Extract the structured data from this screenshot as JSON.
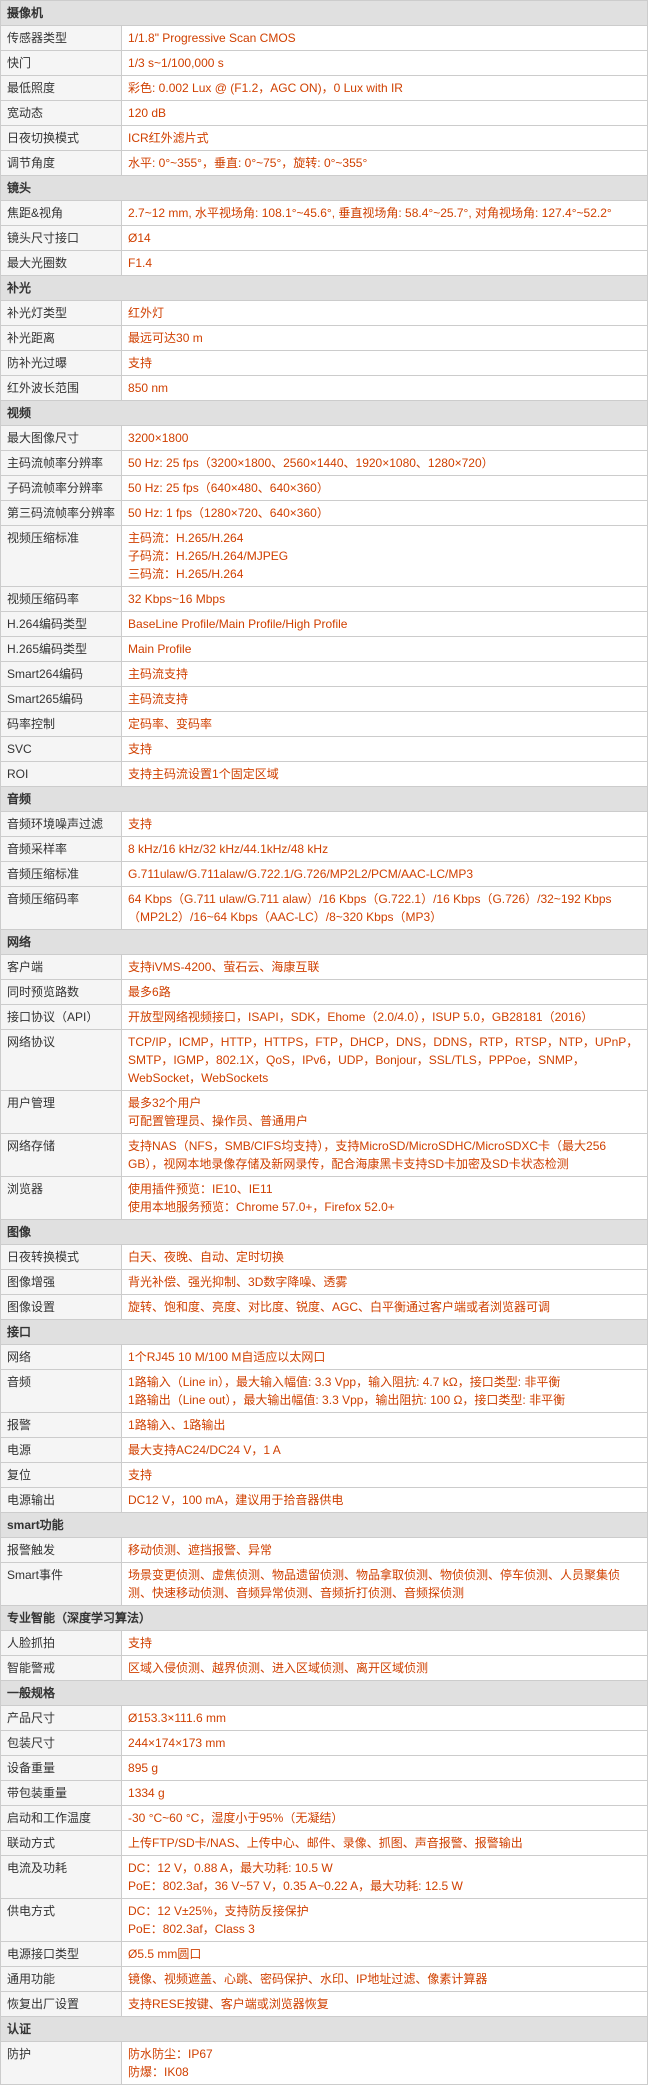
{
  "sections": [
    {
      "header": "摄像机",
      "rows": [
        {
          "label": "传感器类型",
          "value": "1/1.8\" Progressive Scan CMOS"
        },
        {
          "label": "快门",
          "value": "1/3 s~1/100,000 s"
        },
        {
          "label": "最低照度",
          "value": "彩色: 0.002 Lux @ (F1.2，AGC ON)，0 Lux with IR"
        },
        {
          "label": "宽动态",
          "value": "120 dB"
        },
        {
          "label": "日夜切换模式",
          "value": "ICR红外滤片式"
        },
        {
          "label": "调节角度",
          "value": "水平: 0°~355°，垂直: 0°~75°，旋转: 0°~355°"
        }
      ]
    },
    {
      "header": "镜头",
      "rows": [
        {
          "label": "焦距&视角",
          "value": "2.7~12 mm, 水平视场角: 108.1°~45.6°, 垂直视场角: 58.4°~25.7°, 对角视场角: 127.4°~52.2°"
        },
        {
          "label": "镜头尺寸接口",
          "value": "Ø14"
        },
        {
          "label": "最大光圈数",
          "value": "F1.4"
        }
      ]
    },
    {
      "header": "补光",
      "rows": [
        {
          "label": "补光灯类型",
          "value": "红外灯"
        },
        {
          "label": "补光距离",
          "value": "最远可达30 m"
        },
        {
          "label": "防补光过曝",
          "value": "支持"
        },
        {
          "label": "红外波长范围",
          "value": "850 nm"
        }
      ]
    },
    {
      "header": "视频",
      "rows": [
        {
          "label": "最大图像尺寸",
          "value": "3200×1800"
        },
        {
          "label": "主码流帧率分辨率",
          "value": "50 Hz: 25 fps（3200×1800、2560×1440、1920×1080、1280×720）"
        },
        {
          "label": "子码流帧率分辨率",
          "value": "50 Hz: 25 fps（640×480、640×360）"
        },
        {
          "label": "第三码流帧率分辨率",
          "value": "50 Hz: 1 fps（1280×720、640×360）"
        },
        {
          "label": "视频压缩标准",
          "value_multi": [
            "主码流：H.265/H.264",
            "子码流：H.265/H.264/MJPEG",
            "三码流：H.265/H.264"
          ]
        },
        {
          "label": "视频压缩码率",
          "value": "32 Kbps~16 Mbps"
        },
        {
          "label": "H.264编码类型",
          "value": "BaseLine Profile/Main Profile/High Profile"
        },
        {
          "label": "H.265编码类型",
          "value": "Main Profile"
        },
        {
          "label": "Smart264编码",
          "value": "主码流支持"
        },
        {
          "label": "Smart265编码",
          "value": "主码流支持"
        },
        {
          "label": "码率控制",
          "value": "定码率、变码率"
        },
        {
          "label": "SVC",
          "value": "支持"
        },
        {
          "label": "ROI",
          "value": "支持主码流设置1个固定区域"
        }
      ]
    },
    {
      "header": "音频",
      "rows": [
        {
          "label": "音频环境噪声过滤",
          "value": "支持"
        },
        {
          "label": "音频采样率",
          "value": "8 kHz/16 kHz/32 kHz/44.1kHz/48 kHz"
        },
        {
          "label": "音频压缩标准",
          "value": "G.711ulaw/G.711alaw/G.722.1/G.726/MP2L2/PCM/AAC-LC/MP3"
        },
        {
          "label": "音频压缩码率",
          "value": "64 Kbps（G.711 ulaw/G.711 alaw）/16 Kbps（G.722.1）/16 Kbps（G.726）/32~192 Kbps（MP2L2）/16~64 Kbps（AAC-LC）/8~320 Kbps（MP3）"
        }
      ]
    },
    {
      "header": "网络",
      "rows": [
        {
          "label": "客户端",
          "value": "支持iVMS-4200、萤石云、海康互联"
        },
        {
          "label": "同时预览路数",
          "value": "最多6路"
        },
        {
          "label": "接口协议（API）",
          "value": "开放型网络视频接口，ISAPI，SDK，Ehome（2.0/4.0），ISUP 5.0，GB28181（2016）"
        },
        {
          "label": "网络协议",
          "value": "TCP/IP，ICMP，HTTP，HTTPS，FTP，DHCP，DNS，DDNS，RTP，RTSP，NTP，UPnP，SMTP，IGMP，802.1X，QoS，IPv6，UDP，Bonjour，SSL/TLS，PPPoe，SNMP，WebSocket，WebSockets"
        },
        {
          "label": "用户管理",
          "value": "最多32个用户\n可配置管理员、操作员、普通用户"
        },
        {
          "label": "网络存储",
          "value": "支持NAS（NFS，SMB/CIFS均支持），支持MicroSD/MicroSDHC/MicroSDXC卡（最大256 GB），视网本地录像存储及新网录传，配合海康黑卡支持SD卡加密及SD卡状态检测"
        },
        {
          "label": "浏览器",
          "value": "使用插件预览：IE10、IE11\n使用本地服务预览：Chrome 57.0+，Firefox 52.0+"
        }
      ]
    },
    {
      "header": "图像",
      "rows": [
        {
          "label": "日夜转换模式",
          "value": "白天、夜晚、自动、定时切换"
        },
        {
          "label": "图像增强",
          "value": "背光补偿、强光抑制、3D数字降噪、透雾"
        },
        {
          "label": "图像设置",
          "value": "旋转、饱和度、亮度、对比度、锐度、AGC、白平衡通过客户端或者浏览器可调"
        }
      ]
    },
    {
      "header": "接口",
      "rows": [
        {
          "label": "网络",
          "value": "1个RJ45 10 M/100 M自适应以太网口"
        },
        {
          "label": "音频",
          "value": "1路输入（Line in），最大输入幅值: 3.3 Vpp，输入阻抗: 4.7 kΩ，接口类型: 非平衡\n1路输出（Line out），最大输出幅值: 3.3 Vpp，输出阻抗: 100 Ω，接口类型: 非平衡"
        },
        {
          "label": "报警",
          "value": "1路输入、1路输出"
        },
        {
          "label": "电源",
          "value": "最大支持AC24/DC24 V，1 A"
        },
        {
          "label": "复位",
          "value": "支持"
        },
        {
          "label": "电源输出",
          "value": "DC12 V，100 mA，建议用于拾音器供电"
        }
      ]
    },
    {
      "header": "smart功能",
      "rows": [
        {
          "label": "报警触发",
          "value": "移动侦测、遮挡报警、异常"
        },
        {
          "label": "Smart事件",
          "value": "场景变更侦测、虚焦侦测、物品遗留侦测、物品拿取侦测、物侦侦测、停车侦测、人员聚集侦测、快速移动侦测、音频异常侦测、音频折打侦测、音频探侦测"
        }
      ]
    },
    {
      "header": "专业智能（深度学习算法）",
      "rows": [
        {
          "label": "人脸抓拍",
          "value": "支持"
        },
        {
          "label": "智能警戒",
          "value": "区域入侵侦测、越界侦测、进入区域侦测、离开区域侦测"
        }
      ]
    },
    {
      "header": "一般规格",
      "rows": [
        {
          "label": "产品尺寸",
          "value": "Ø153.3×111.6 mm"
        },
        {
          "label": "包装尺寸",
          "value": "244×174×173 mm"
        },
        {
          "label": "设备重量",
          "value": "895 g"
        },
        {
          "label": "带包装重量",
          "value": "1334 g"
        },
        {
          "label": "启动和工作温度",
          "value": "-30 °C~60 °C，湿度小于95%（无凝结）"
        },
        {
          "label": "联动方式",
          "value": "上传FTP/SD卡/NAS、上传中心、邮件、录像、抓图、声音报警、报警输出"
        },
        {
          "label": "电流及功耗",
          "value": "DC：12 V，0.88 A，最大功耗: 10.5 W\nPoE：802.3af，36 V~57 V，0.35 A~0.22 A，最大功耗: 12.5 W"
        },
        {
          "label": "供电方式",
          "value": "DC：12 V±25%，支持防反接保护\nPoE：802.3af，Class 3"
        },
        {
          "label": "电源接口类型",
          "value": "Ø5.5 mm圆口"
        },
        {
          "label": "通用功能",
          "value": "镜像、视频遮盖、心跳、密码保护、水印、IP地址过滤、像素计算器"
        },
        {
          "label": "恢复出厂设置",
          "value": "支持RESE按键、客户端或浏览器恢复"
        }
      ]
    },
    {
      "header": "认证",
      "rows": [
        {
          "label": "防护",
          "value": "防水防尘：IP67\n防爆：IK08"
        }
      ]
    }
  ]
}
